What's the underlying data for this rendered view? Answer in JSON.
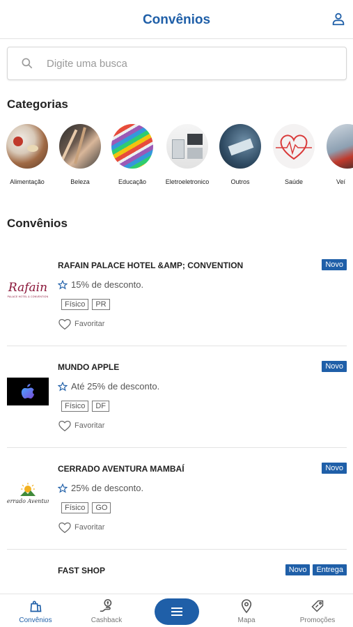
{
  "header": {
    "title": "Convênios"
  },
  "search": {
    "placeholder": "Digite uma busca"
  },
  "categories": {
    "title": "Categorias",
    "items": [
      {
        "label": "Alimentação"
      },
      {
        "label": "Beleza"
      },
      {
        "label": "Educação"
      },
      {
        "label": "Eletroeletronico"
      },
      {
        "label": "Outros"
      },
      {
        "label": "Saúde"
      },
      {
        "label": "Veí"
      }
    ]
  },
  "convenios": {
    "title": "Convênios",
    "favorite_label": "Favoritar",
    "items": [
      {
        "name": "RAFAIN PALACE HOTEL &AMP; CONVENTION",
        "discount": "15% de desconto.",
        "tags": [
          "Físico",
          "PR"
        ],
        "badges": [
          "Novo"
        ],
        "logo_text": "Rafain",
        "logo_sub": "PALACE HOTEL & CONVENTION"
      },
      {
        "name": "MUNDO APPLE",
        "discount": "Até 25% de desconto.",
        "tags": [
          "Físico",
          "DF"
        ],
        "badges": [
          "Novo"
        ]
      },
      {
        "name": "CERRADO AVENTURA MAMBAÍ",
        "discount": "25% de desconto.",
        "tags": [
          "Físico",
          "GO"
        ],
        "badges": [
          "Novo"
        ],
        "logo_text": "Cerrado Aventura"
      },
      {
        "name": "FAST SHOP",
        "badges": [
          "Novo",
          "Entrega"
        ]
      }
    ]
  },
  "tabbar": {
    "items": [
      {
        "label": "Convênios",
        "icon": "bag-icon"
      },
      {
        "label": "Cashback",
        "icon": "cashback-icon"
      },
      {
        "label": "Mapa",
        "icon": "map-pin-icon"
      },
      {
        "label": "Promoções",
        "icon": "tag-icon"
      }
    ]
  },
  "colors": {
    "primary": "#1f5fa8",
    "badge_bg": "#1f5fa8",
    "text": "#222222"
  }
}
